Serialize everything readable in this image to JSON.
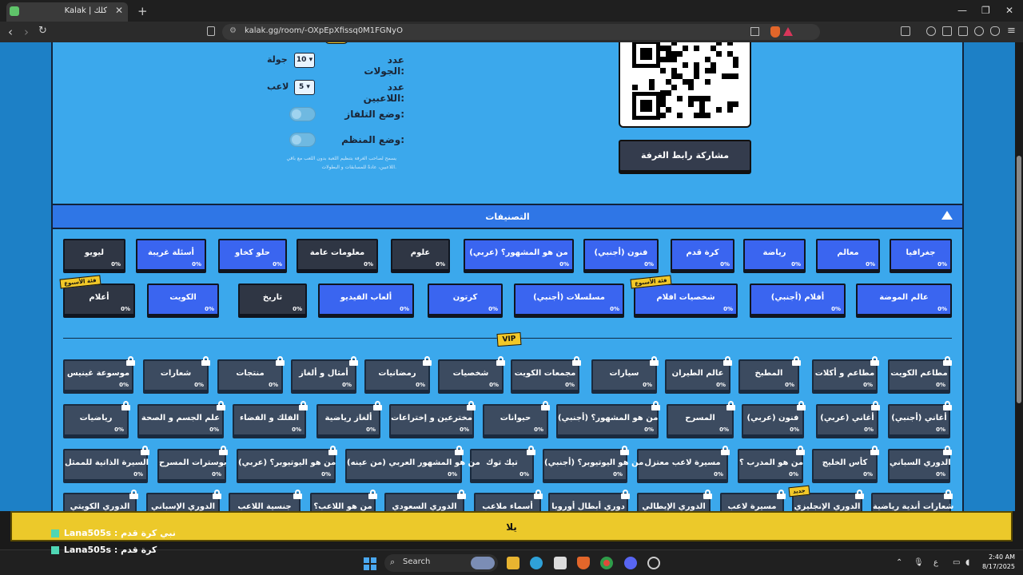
{
  "browser": {
    "tab_title": "Kalak | كلك",
    "close_tab": "✕",
    "new_tab": "+",
    "url": "kalak.gg/room/-OXpEpXfissq0M1FGNyO",
    "window_controls": {
      "minimize": "—",
      "restore": "❐",
      "close": "✕"
    }
  },
  "settings": {
    "rounds_label": "عدد الجولات:",
    "rounds_value": "10",
    "rounds_unit": "جولة",
    "players_label": "عدد اللاعبين:",
    "players_value": "5",
    "players_unit": "لاعب",
    "tv_mode_label": "وضع التلفاز:",
    "organizer_mode_label": "وضع المنظم:",
    "organizer_hint": "يسمح لصاحب الغرفة بتنظيم اللعبة بدون اللعب مع باقي اللاعبين، عادةً للمسابقات و البطولات.",
    "share_button": "مشاركة رابط الغرفة"
  },
  "categories": {
    "title": "التصنيفات",
    "vip_tag": "VIP",
    "row1": [
      {
        "label": "جغرافيا",
        "pct": "0%",
        "style": "blue"
      },
      {
        "label": "معالم",
        "pct": "0%",
        "style": "blue"
      },
      {
        "label": "رياضة",
        "pct": "0%",
        "style": "blue"
      },
      {
        "label": "كرة قدم",
        "pct": "0%",
        "style": "blue"
      },
      {
        "label": "فنون (أجنبي)",
        "pct": "0%",
        "style": "blue"
      },
      {
        "label": "من هو المشهور؟ (عربي)",
        "pct": "0%",
        "style": "blue"
      },
      {
        "label": "علوم",
        "pct": "0%",
        "style": "dark"
      },
      {
        "label": "معلومات عامة",
        "pct": "0%",
        "style": "dark"
      },
      {
        "label": "حلو كخاو",
        "pct": "0%",
        "style": "blue"
      },
      {
        "label": "أسئلة غريبة",
        "pct": "0%",
        "style": "blue"
      },
      {
        "label": "ليويو",
        "pct": "0%",
        "style": "dark"
      }
    ],
    "row2": [
      {
        "label": "عالم الموضة",
        "pct": "0%",
        "style": "blue"
      },
      {
        "label": "أفلام (أجنبي)",
        "pct": "0%",
        "style": "blue"
      },
      {
        "label": "شخصيات افلام",
        "pct": "0%",
        "style": "blue",
        "badge": "فئة الأسبوع"
      },
      {
        "label": "مسلسلات (أجنبي)",
        "pct": "0%",
        "style": "blue"
      },
      {
        "label": "كرتون",
        "pct": "0%",
        "style": "blue"
      },
      {
        "label": "ألعاب الفيديو",
        "pct": "0%",
        "style": "blue"
      },
      {
        "label": "تاريخ",
        "pct": "0%",
        "style": "dark"
      },
      {
        "label": "الكويت",
        "pct": "0%",
        "style": "blue"
      },
      {
        "label": "أعلام",
        "pct": "0%",
        "style": "dark",
        "badge": "فئة الأسبوع"
      }
    ],
    "vip_row1": [
      {
        "label": "مطاعم الكويت",
        "pct": "0%"
      },
      {
        "label": "مطاعم و أكلات",
        "pct": "0%"
      },
      {
        "label": "المطبخ",
        "pct": "0%"
      },
      {
        "label": "عالم الطيران",
        "pct": "0%"
      },
      {
        "label": "سيارات",
        "pct": "0%"
      },
      {
        "label": "مجمعات الكويت",
        "pct": "0%"
      },
      {
        "label": "شخصيات",
        "pct": "0%"
      },
      {
        "label": "رمضانيات",
        "pct": "0%"
      },
      {
        "label": "أمثال و ألغاز",
        "pct": "0%"
      },
      {
        "label": "منتجات",
        "pct": "0%"
      },
      {
        "label": "شعارات",
        "pct": "0%"
      },
      {
        "label": "موسوعة غينيس",
        "pct": "0%"
      }
    ],
    "vip_row2": [
      {
        "label": "أغاني (أجنبي)",
        "pct": "0%"
      },
      {
        "label": "أغاني (عربي)",
        "pct": "0%"
      },
      {
        "label": "فنون (عربي)",
        "pct": "0%"
      },
      {
        "label": "المسرح",
        "pct": "0%"
      },
      {
        "label": "من هو المشهور؟ (أجنبي)",
        "pct": "0%"
      },
      {
        "label": "حيوانات",
        "pct": "0%"
      },
      {
        "label": "مخترعين و إختراعات",
        "pct": "0%"
      },
      {
        "label": "ألغاز رياضية",
        "pct": "0%"
      },
      {
        "label": "الفلك و الفضاء",
        "pct": "0%"
      },
      {
        "label": "علم الجسم و الصحة",
        "pct": "0%"
      },
      {
        "label": "رياضيات",
        "pct": "0%"
      }
    ],
    "vip_row3": [
      {
        "label": "الدوري السباني",
        "pct": "0%"
      },
      {
        "label": "كأس الخليج",
        "pct": "0%"
      },
      {
        "label": "من هو المدرب ؟",
        "pct": "0%"
      },
      {
        "label": "مسيرة لاعب معتزل",
        "pct": "0%"
      },
      {
        "label": "من هو اليوتيوبر؟ (أجنبي)",
        "pct": "0%"
      },
      {
        "label": "تيك توك",
        "pct": "0%"
      },
      {
        "label": "من هو المشهور العربي (من عينه)",
        "pct": "0%"
      },
      {
        "label": "من هو اليوتيوبر؟ (عربي)",
        "pct": "0%"
      },
      {
        "label": "بوسترات المسرح",
        "pct": "0%"
      },
      {
        "label": "السيرة الذاتية للممثل",
        "pct": "0%"
      }
    ],
    "vip_row4": [
      {
        "label": "شعارات أندية رياضية"
      },
      {
        "label": "الدوري الإنجليزي",
        "badge": "جديد"
      },
      {
        "label": "مسيرة لاعب"
      },
      {
        "label": "الدوري الإيطالي"
      },
      {
        "label": "دوري أبطال أوروبا"
      },
      {
        "label": "أسماء ملاعب"
      },
      {
        "label": "الدوري السعودي"
      },
      {
        "label": "من هو اللاعب؟"
      },
      {
        "label": "جنسية اللاعب"
      },
      {
        "label": "الدوري الإسباني"
      },
      {
        "label": "الدوري الكويتي"
      }
    ]
  },
  "banner": {
    "text": "يلا",
    "chat": [
      {
        "user": "Lana505s :",
        "message": "نبي كرة قدم"
      },
      {
        "user": "Lana505s :",
        "message": "كرة قدم"
      }
    ]
  },
  "taskbar": {
    "search": "Search",
    "time": "2:40 AM",
    "date": "8/17/2025",
    "lang": "ع"
  },
  "colors": {
    "page_bg": "#1d80c6",
    "panel": "#3ba8ec",
    "chip_blue": "#3a65f0",
    "chip_dark": "#2f3644",
    "banner": "#ecc92a"
  }
}
